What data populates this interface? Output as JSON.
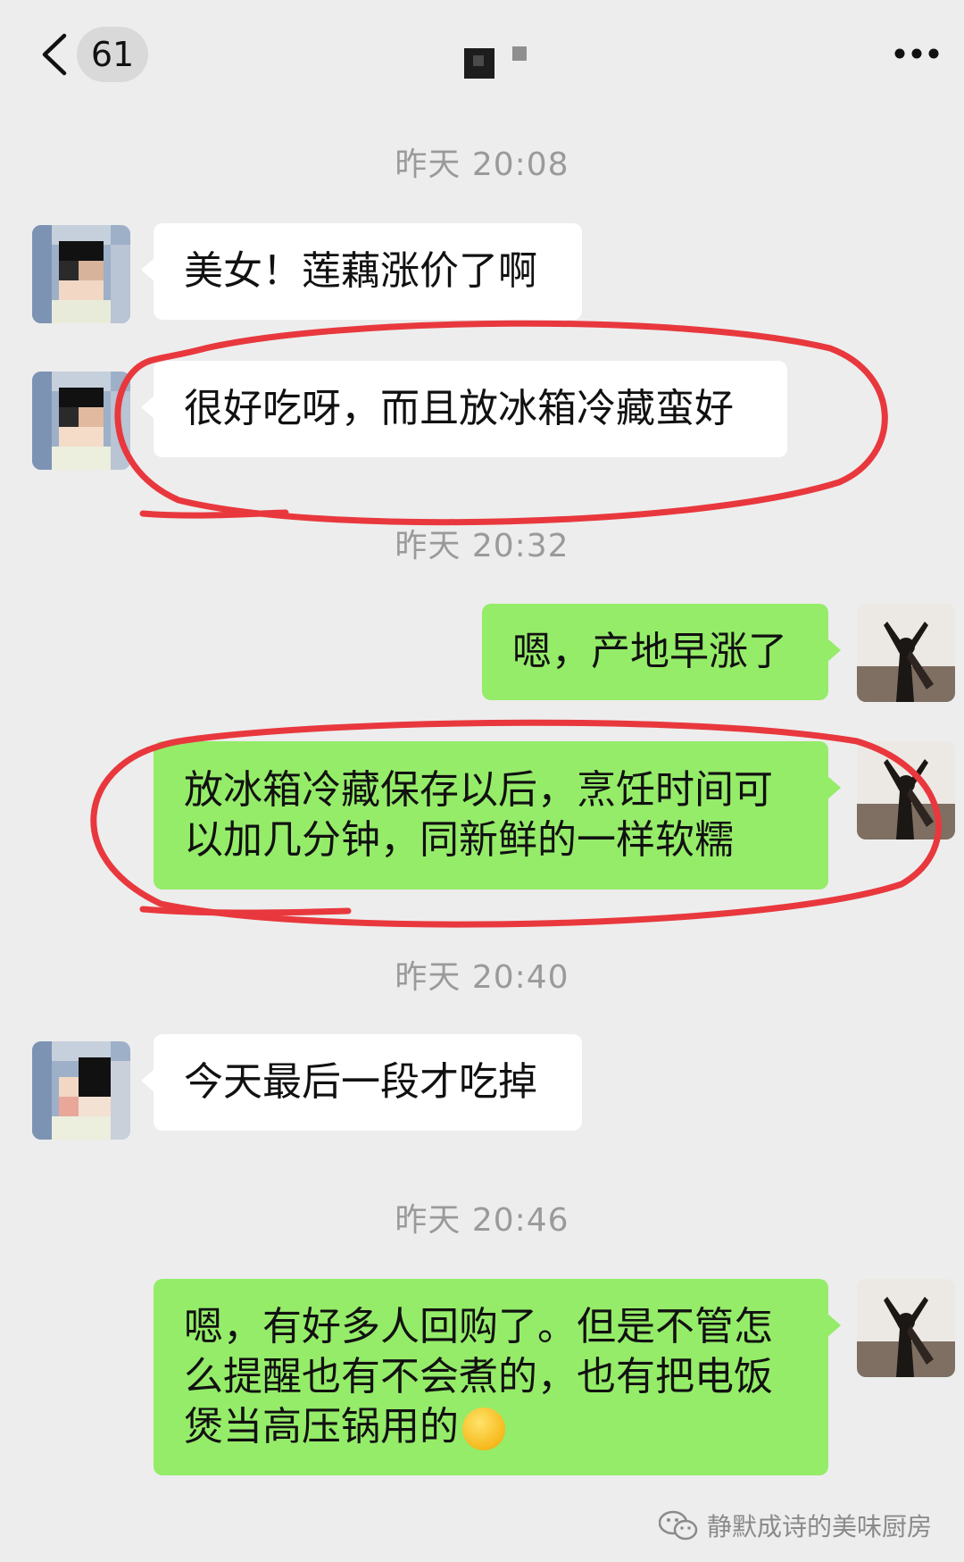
{
  "header": {
    "back_label": "<",
    "unread_count": "61",
    "more_icon": "more-icon"
  },
  "messages": [
    {
      "time": "昨天 20:08"
    },
    {
      "side": "in",
      "text": "美女！莲藕涨价了啊"
    },
    {
      "side": "in",
      "text": "很好吃呀，而且放冰箱冷藏蛮好"
    },
    {
      "time": "昨天 20:32"
    },
    {
      "side": "out",
      "text": "嗯，产地早涨了"
    },
    {
      "side": "out",
      "text": "放冰箱冷藏保存以后，烹饪时间可\n以加几分钟，同新鲜的一样软糯"
    },
    {
      "time": "昨天 20:40"
    },
    {
      "side": "in",
      "text": "今天最后一段才吃掉"
    },
    {
      "time": "昨天 20:46"
    },
    {
      "side": "out",
      "text": "嗯，有好多人回购了。但是不管怎\n么提醒也有不会煮的，也有把电饭\n煲当高压锅用的",
      "emoji": "thinking-face-emoji"
    }
  ],
  "watermark": "静默成诗的美味厨房",
  "colors": {
    "background": "#ededed",
    "incoming_bubble": "#ffffff",
    "outgoing_bubble": "#95ec69",
    "annotation": "#e8383d"
  }
}
